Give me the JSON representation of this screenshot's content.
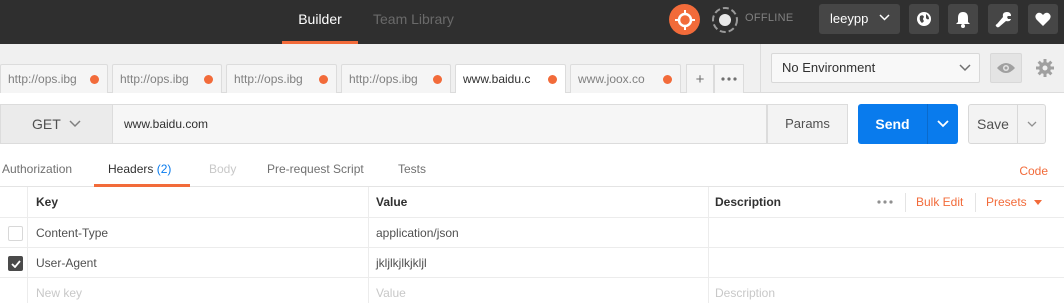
{
  "topbar": {
    "tabs": [
      {
        "label": "Builder",
        "active": true
      },
      {
        "label": "Team Library",
        "active": false
      }
    ],
    "status_text": "OFFLINE",
    "user": "leeypp",
    "icons": [
      "sync-icon",
      "offline-icon",
      "globe-icon",
      "bell-icon",
      "wrench-icon",
      "heart-icon"
    ],
    "accent_color": "#f26b3a"
  },
  "request_tabs": [
    {
      "label": "http://ops.ibg",
      "active": false,
      "unsaved": true
    },
    {
      "label": "http://ops.ibg",
      "active": false,
      "unsaved": true
    },
    {
      "label": "http://ops.ibg",
      "active": false,
      "unsaved": true
    },
    {
      "label": "http://ops.ibg",
      "active": false,
      "unsaved": true
    },
    {
      "label": "www.baidu.c",
      "active": true,
      "unsaved": true
    },
    {
      "label": "www.joox.co",
      "active": false,
      "unsaved": true
    }
  ],
  "add_tab_label": "+",
  "environment": {
    "selected": "No Environment"
  },
  "request": {
    "method": "GET",
    "url": "www.baidu.com",
    "params_label": "Params",
    "send_label": "Send",
    "save_label": "Save",
    "send_color": "#097bed"
  },
  "subtabs": [
    {
      "label": "Authorization",
      "state": "normal"
    },
    {
      "label": "Headers",
      "count": "(2)",
      "state": "active"
    },
    {
      "label": "Body",
      "state": "disabled"
    },
    {
      "label": "Pre-request Script",
      "state": "normal"
    },
    {
      "label": "Tests",
      "state": "normal"
    }
  ],
  "code_link": "Code",
  "headers_table": {
    "columns": {
      "key": "Key",
      "value": "Value",
      "description": "Description"
    },
    "bulk_edit_label": "Bulk Edit",
    "presets_label": "Presets",
    "rows": [
      {
        "checked": false,
        "key": "Content-Type",
        "value": "application/json",
        "description": ""
      },
      {
        "checked": true,
        "key": "User-Agent",
        "value": "jkljlkjlkjkljl",
        "description": ""
      }
    ],
    "new_row": {
      "key_placeholder": "New key",
      "value_placeholder": "Value",
      "description_placeholder": "Description"
    }
  }
}
